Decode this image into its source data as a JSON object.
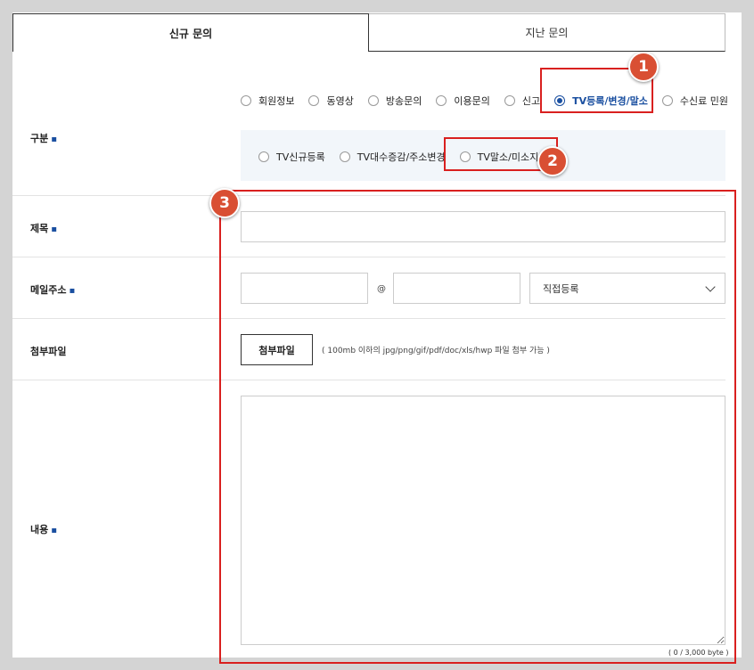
{
  "tabs": [
    {
      "label": "신규 문의",
      "active": true
    },
    {
      "label": "지난 문의",
      "active": false
    }
  ],
  "category": {
    "label": "구분",
    "required_mark": "▪",
    "options": [
      "회원정보",
      "동영상",
      "방송문의",
      "이용문의",
      "신고",
      "TV등록/변경/말소",
      "수신료 민원"
    ],
    "selected": "TV등록/변경/말소",
    "sub_options": [
      "TV신규등록",
      "TV대수증감/주소변경",
      "TV말소/미소지"
    ]
  },
  "title_field": {
    "label": "제목",
    "required_mark": "▪",
    "value": ""
  },
  "email": {
    "label": "메일주소",
    "required_mark": "▪",
    "local_value": "",
    "at": "@",
    "domain_value": "",
    "select_value": "직접등록"
  },
  "attachment": {
    "label": "첨부파일",
    "button_label": "첨부파일",
    "note": "( 100mb 이하의 jpg/png/gif/pdf/doc/xls/hwp 파일 첨부 가능 )"
  },
  "content": {
    "label": "내용",
    "required_mark": "▪",
    "value": "",
    "byte_counter": "( 0 / 3,000 byte )"
  },
  "annotations": {
    "badge_1": "1",
    "badge_2": "2",
    "badge_3": "3",
    "highlight_color": "#d9201f",
    "badge_color": "#d94f33"
  },
  "colors": {
    "accent": "#1a4fa0",
    "sub_box_bg": "#f2f6fa"
  }
}
